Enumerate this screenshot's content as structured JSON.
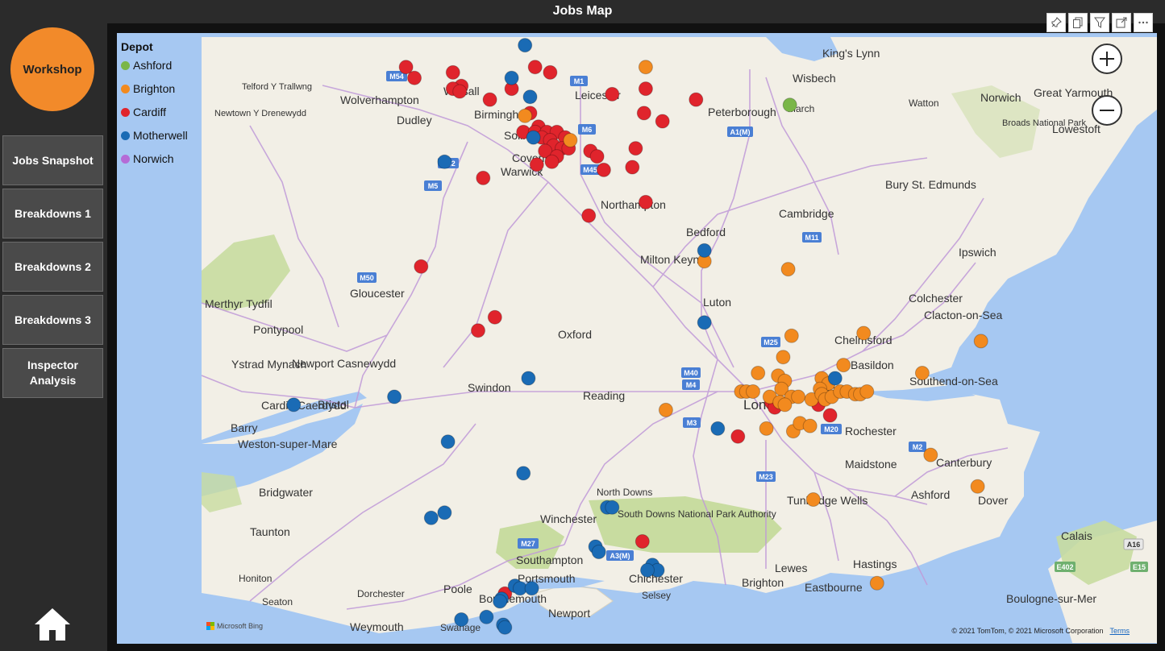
{
  "page": {
    "title": "Jobs Map"
  },
  "sidebar": {
    "workshop_label": "Workshop",
    "buttons": [
      "Jobs Snapshot",
      "Breakdowns 1",
      "Breakdowns 2",
      "Breakdowns 3",
      "Inspector Analysis"
    ],
    "home_icon": "home-icon"
  },
  "toolbar": {
    "icons": [
      "pin-icon",
      "copy-icon",
      "filter-icon",
      "focus-mode-icon",
      "more-options-icon"
    ]
  },
  "map_controls": {
    "zoom_in_icon": "plus-icon",
    "zoom_out_icon": "minus-icon"
  },
  "legend": {
    "title": "Depot",
    "items": [
      {
        "label": "Ashford",
        "color": "#7ab648"
      },
      {
        "label": "Brighton",
        "color": "#f28a1f"
      },
      {
        "label": "Cardiff",
        "color": "#e0242c"
      },
      {
        "label": "Motherwell",
        "color": "#1a6bb5"
      },
      {
        "label": "Norwich",
        "color": "#b56bd6"
      }
    ]
  },
  "map": {
    "colors": {
      "land": "#f2efe6",
      "sea": "#a6c8f2",
      "park": "#c8dca0",
      "road": "#c09ad8",
      "motorway_sign": "#4a7fd4"
    },
    "places": [
      "King's Lynn",
      "Wisbech",
      "Norwich",
      "Great Yarmouth",
      "Lowestoft",
      "Broads National Park",
      "Watton",
      "March",
      "Peterborough",
      "Leicester",
      "Walsall",
      "Wolverhampton",
      "Dudley",
      "Birmingham",
      "Solihull",
      "Coventry",
      "Warwick",
      "Newtown Y Drenewydd",
      "Telford Y Trallwng",
      "Bury St. Edmunds",
      "Cambridge",
      "Northampton",
      "Bedford",
      "Ipswich",
      "Milton Keynes",
      "Luton",
      "Colchester",
      "Clacton-on-Sea",
      "Chelmsford",
      "Merthyr Tydfil",
      "Pontypool",
      "Gloucester",
      "Oxford",
      "Ystrad Mynach",
      "Newport Casnewydd",
      "Basildon",
      "Southend-on-Sea",
      "Cardiff Caerdydd",
      "Bristol",
      "Swindon",
      "Reading",
      "London",
      "Grays",
      "Barry",
      "Weston-super-Mare",
      "Rochester",
      "Maidstone",
      "Canterbury",
      "Bridgwater",
      "North Downs",
      "Tunbridge Wells",
      "Ashford",
      "Dover",
      "Winchester",
      "South Downs National Park Authority",
      "Taunton",
      "Southampton",
      "Calais",
      "Honiton",
      "Portsmouth",
      "Chichester",
      "Lewes",
      "Hastings",
      "Brighton",
      "Eastbourne",
      "Dorchester",
      "Poole",
      "Bournemouth",
      "Selsey",
      "Boulogne-sur-Mer",
      "Seaton",
      "Newport",
      "Weymouth",
      "Swanage"
    ],
    "road_signs": [
      "M54",
      "M1",
      "M6",
      "M42",
      "M5",
      "M45",
      "A1(M)",
      "M11",
      "M50",
      "M40",
      "M25",
      "M4",
      "M3",
      "M20",
      "M2",
      "M23",
      "M27",
      "A3(M)",
      "A16",
      "E402",
      "E15"
    ],
    "jobs": [
      {
        "depot": "Cardiff",
        "lon": -2.53,
        "lat": 52.72
      },
      {
        "depot": "Cardiff",
        "lon": -2.48,
        "lat": 52.68
      },
      {
        "depot": "Cardiff",
        "lon": -2.25,
        "lat": 52.7
      },
      {
        "depot": "Cardiff",
        "lon": -2.2,
        "lat": 52.65
      },
      {
        "depot": "Cardiff",
        "lon": -2.25,
        "lat": 52.64
      },
      {
        "depot": "Cardiff",
        "lon": -2.21,
        "lat": 52.63
      },
      {
        "depot": "Cardiff",
        "lon": -2.03,
        "lat": 52.6
      },
      {
        "depot": "Cardiff",
        "lon": -1.9,
        "lat": 52.64
      },
      {
        "depot": "Cardiff",
        "lon": -1.67,
        "lat": 52.7
      },
      {
        "depot": "Cardiff",
        "lon": -1.3,
        "lat": 52.62
      },
      {
        "depot": "Cardiff",
        "lon": -1.1,
        "lat": 52.64
      },
      {
        "depot": "Cardiff",
        "lon": -1.11,
        "lat": 52.55
      },
      {
        "depot": "Cardiff",
        "lon": -1.0,
        "lat": 52.52
      },
      {
        "depot": "Cardiff",
        "lon": -0.8,
        "lat": 52.6
      },
      {
        "depot": "Cardiff",
        "lon": -1.76,
        "lat": 52.72
      },
      {
        "depot": "Cardiff",
        "lon": -1.79,
        "lat": 52.55
      },
      {
        "depot": "Cardiff",
        "lon": -1.74,
        "lat": 52.5
      },
      {
        "depot": "Cardiff",
        "lon": -1.83,
        "lat": 52.48
      },
      {
        "depot": "Cardiff",
        "lon": -1.76,
        "lat": 52.48
      },
      {
        "depot": "Cardiff",
        "lon": -1.69,
        "lat": 52.48
      },
      {
        "depot": "Cardiff",
        "lon": -1.63,
        "lat": 52.48
      },
      {
        "depot": "Cardiff",
        "lon": -1.72,
        "lat": 52.46
      },
      {
        "depot": "Cardiff",
        "lon": -1.67,
        "lat": 52.45
      },
      {
        "depot": "Cardiff",
        "lon": -1.58,
        "lat": 52.46
      },
      {
        "depot": "Cardiff",
        "lon": -1.65,
        "lat": 52.43
      },
      {
        "depot": "Cardiff",
        "lon": -1.6,
        "lat": 52.42
      },
      {
        "depot": "Cardiff",
        "lon": -1.56,
        "lat": 52.42
      },
      {
        "depot": "Cardiff",
        "lon": -1.7,
        "lat": 52.41
      },
      {
        "depot": "Cardiff",
        "lon": -1.63,
        "lat": 52.39
      },
      {
        "depot": "Cardiff",
        "lon": -1.66,
        "lat": 52.37
      },
      {
        "depot": "Cardiff",
        "lon": -1.43,
        "lat": 52.41
      },
      {
        "depot": "Cardiff",
        "lon": -1.39,
        "lat": 52.39
      },
      {
        "depot": "Cardiff",
        "lon": -1.35,
        "lat": 52.34
      },
      {
        "depot": "Cardiff",
        "lon": -1.16,
        "lat": 52.42
      },
      {
        "depot": "Cardiff",
        "lon": -1.18,
        "lat": 52.35
      },
      {
        "depot": "Cardiff",
        "lon": -1.75,
        "lat": 52.36
      },
      {
        "depot": "Cardiff",
        "lon": -2.07,
        "lat": 52.31
      },
      {
        "depot": "Cardiff",
        "lon": -1.1,
        "lat": 52.22
      },
      {
        "depot": "Cardiff",
        "lon": -1.44,
        "lat": 52.17
      },
      {
        "depot": "Cardiff",
        "lon": -2.44,
        "lat": 51.98
      },
      {
        "depot": "Cardiff",
        "lon": -2.0,
        "lat": 51.79
      },
      {
        "depot": "Cardiff",
        "lon": -2.1,
        "lat": 51.74
      },
      {
        "depot": "Cardiff",
        "lon": -0.35,
        "lat": 51.47
      },
      {
        "depot": "Cardiff",
        "lon": -0.33,
        "lat": 51.45
      },
      {
        "depot": "Cardiff",
        "lon": -0.07,
        "lat": 51.46
      },
      {
        "depot": "Cardiff",
        "lon": 0.0,
        "lat": 51.42
      },
      {
        "depot": "Cardiff",
        "lon": -0.55,
        "lat": 51.34
      },
      {
        "depot": "Cardiff",
        "lon": -1.12,
        "lat": 50.94
      },
      {
        "depot": "Cardiff",
        "lon": -1.94,
        "lat": 50.74
      },
      {
        "depot": "Brighton",
        "lon": -1.82,
        "lat": 52.54
      },
      {
        "depot": "Brighton",
        "lon": -1.55,
        "lat": 52.45
      },
      {
        "depot": "Brighton",
        "lon": -1.1,
        "lat": 52.72
      },
      {
        "depot": "Brighton",
        "lon": -0.75,
        "lat": 52.0
      },
      {
        "depot": "Brighton",
        "lon": -0.25,
        "lat": 51.97
      },
      {
        "depot": "Brighton",
        "lon": -0.23,
        "lat": 51.72
      },
      {
        "depot": "Brighton",
        "lon": 0.2,
        "lat": 51.73
      },
      {
        "depot": "Brighton",
        "lon": -0.28,
        "lat": 51.64
      },
      {
        "depot": "Brighton",
        "lon": 0.08,
        "lat": 51.61
      },
      {
        "depot": "Brighton",
        "lon": -0.43,
        "lat": 51.58
      },
      {
        "depot": "Brighton",
        "lon": -0.31,
        "lat": 51.57
      },
      {
        "depot": "Brighton",
        "lon": -0.27,
        "lat": 51.55
      },
      {
        "depot": "Brighton",
        "lon": -0.05,
        "lat": 51.56
      },
      {
        "depot": "Brighton",
        "lon": -0.01,
        "lat": 51.54
      },
      {
        "depot": "Brighton",
        "lon": -0.53,
        "lat": 51.51
      },
      {
        "depot": "Brighton",
        "lon": -0.5,
        "lat": 51.51
      },
      {
        "depot": "Brighton",
        "lon": -0.46,
        "lat": 51.51
      },
      {
        "depot": "Brighton",
        "lon": -0.29,
        "lat": 51.52
      },
      {
        "depot": "Brighton",
        "lon": -0.36,
        "lat": 51.49
      },
      {
        "depot": "Brighton",
        "lon": -0.3,
        "lat": 51.47
      },
      {
        "depot": "Brighton",
        "lon": -0.23,
        "lat": 51.49
      },
      {
        "depot": "Brighton",
        "lon": -0.19,
        "lat": 51.49
      },
      {
        "depot": "Brighton",
        "lon": -0.11,
        "lat": 51.48
      },
      {
        "depot": "Brighton",
        "lon": -0.06,
        "lat": 51.52
      },
      {
        "depot": "Brighton",
        "lon": -0.05,
        "lat": 51.5
      },
      {
        "depot": "Brighton",
        "lon": -0.03,
        "lat": 51.48
      },
      {
        "depot": "Brighton",
        "lon": 0.01,
        "lat": 51.49
      },
      {
        "depot": "Brighton",
        "lon": 0.06,
        "lat": 51.51
      },
      {
        "depot": "Brighton",
        "lon": 0.1,
        "lat": 51.51
      },
      {
        "depot": "Brighton",
        "lon": 0.15,
        "lat": 51.5
      },
      {
        "depot": "Brighton",
        "lon": 0.18,
        "lat": 51.5
      },
      {
        "depot": "Brighton",
        "lon": 0.22,
        "lat": 51.51
      },
      {
        "depot": "Brighton",
        "lon": -0.27,
        "lat": 51.46
      },
      {
        "depot": "Brighton",
        "lon": -0.38,
        "lat": 51.37
      },
      {
        "depot": "Brighton",
        "lon": -0.22,
        "lat": 51.36
      },
      {
        "depot": "Brighton",
        "lon": -0.18,
        "lat": 51.39
      },
      {
        "depot": "Brighton",
        "lon": -0.12,
        "lat": 51.38
      },
      {
        "depot": "Brighton",
        "lon": -0.98,
        "lat": 51.44
      },
      {
        "depot": "Brighton",
        "lon": 0.55,
        "lat": 51.58
      },
      {
        "depot": "Brighton",
        "lon": 0.9,
        "lat": 51.7
      },
      {
        "depot": "Brighton",
        "lon": 0.6,
        "lat": 51.27
      },
      {
        "depot": "Brighton",
        "lon": 0.88,
        "lat": 51.15
      },
      {
        "depot": "Brighton",
        "lon": -0.1,
        "lat": 51.1
      },
      {
        "depot": "Brighton",
        "lon": 0.28,
        "lat": 50.78
      },
      {
        "depot": "Ashford",
        "lon": -0.24,
        "lat": 52.58
      },
      {
        "depot": "Motherwell",
        "lon": -1.82,
        "lat": 52.8
      },
      {
        "depot": "Motherwell",
        "lon": -1.9,
        "lat": 52.68
      },
      {
        "depot": "Motherwell",
        "lon": -1.79,
        "lat": 52.61
      },
      {
        "depot": "Motherwell",
        "lon": -1.77,
        "lat": 52.46
      },
      {
        "depot": "Motherwell",
        "lon": -2.3,
        "lat": 52.37
      },
      {
        "depot": "Motherwell",
        "lon": -0.75,
        "lat": 52.04
      },
      {
        "depot": "Motherwell",
        "lon": -0.75,
        "lat": 51.77
      },
      {
        "depot": "Motherwell",
        "lon": 0.03,
        "lat": 51.56
      },
      {
        "depot": "Motherwell",
        "lon": -2.6,
        "lat": 51.49
      },
      {
        "depot": "Motherwell",
        "lon": -3.2,
        "lat": 51.46
      },
      {
        "depot": "Motherwell",
        "lon": -1.8,
        "lat": 51.56
      },
      {
        "depot": "Motherwell",
        "lon": -0.67,
        "lat": 51.37
      },
      {
        "depot": "Motherwell",
        "lon": -2.28,
        "lat": 51.32
      },
      {
        "depot": "Motherwell",
        "lon": -1.83,
        "lat": 51.2
      },
      {
        "depot": "Motherwell",
        "lon": -1.33,
        "lat": 51.07
      },
      {
        "depot": "Motherwell",
        "lon": -1.3,
        "lat": 51.07
      },
      {
        "depot": "Motherwell",
        "lon": -2.3,
        "lat": 51.05
      },
      {
        "depot": "Motherwell",
        "lon": -2.38,
        "lat": 51.03
      },
      {
        "depot": "Motherwell",
        "lon": -1.4,
        "lat": 50.92
      },
      {
        "depot": "Motherwell",
        "lon": -1.38,
        "lat": 50.9
      },
      {
        "depot": "Motherwell",
        "lon": -1.06,
        "lat": 50.85
      },
      {
        "depot": "Motherwell",
        "lon": -1.03,
        "lat": 50.83
      },
      {
        "depot": "Motherwell",
        "lon": -1.09,
        "lat": 50.83
      },
      {
        "depot": "Motherwell",
        "lon": -1.88,
        "lat": 50.77
      },
      {
        "depot": "Motherwell",
        "lon": -1.85,
        "lat": 50.76
      },
      {
        "depot": "Motherwell",
        "lon": -1.78,
        "lat": 50.76
      },
      {
        "depot": "Motherwell",
        "lon": -1.96,
        "lat": 50.72
      },
      {
        "depot": "Motherwell",
        "lon": -1.97,
        "lat": 50.71
      },
      {
        "depot": "Motherwell",
        "lon": -2.05,
        "lat": 50.65
      },
      {
        "depot": "Motherwell",
        "lon": -2.2,
        "lat": 50.64
      },
      {
        "depot": "Motherwell",
        "lon": -1.95,
        "lat": 50.62
      },
      {
        "depot": "Motherwell",
        "lon": -1.94,
        "lat": 50.61
      }
    ]
  },
  "attribution": {
    "text": "© 2021 TomTom, © 2021 Microsoft Corporation",
    "link": "Terms",
    "logo_text": "Microsoft Bing"
  }
}
